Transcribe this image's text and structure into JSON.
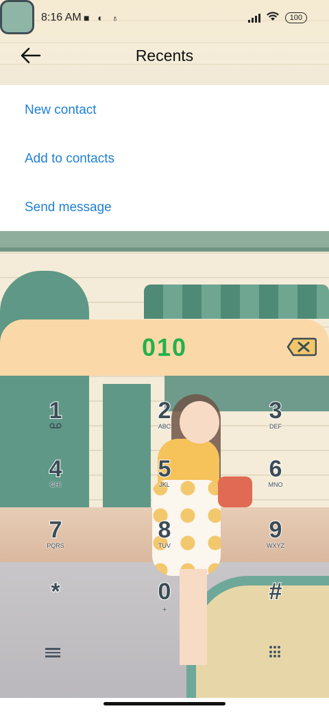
{
  "status_bar": {
    "time": "8:16 AM",
    "battery": "100"
  },
  "header": {
    "title": "Recents"
  },
  "menu": {
    "items": [
      {
        "label": "New contact"
      },
      {
        "label": "Add to contacts"
      },
      {
        "label": "Send message"
      }
    ]
  },
  "dialer": {
    "number": "010",
    "keys": [
      {
        "digit": "1",
        "letters": ""
      },
      {
        "digit": "2",
        "letters": "ABC"
      },
      {
        "digit": "3",
        "letters": "DEF"
      },
      {
        "digit": "4",
        "letters": "GHI"
      },
      {
        "digit": "5",
        "letters": "JKL"
      },
      {
        "digit": "6",
        "letters": "MNO"
      },
      {
        "digit": "7",
        "letters": "PQRS"
      },
      {
        "digit": "8",
        "letters": "TUV"
      },
      {
        "digit": "9",
        "letters": "WXYZ"
      },
      {
        "digit": "*",
        "letters": ""
      },
      {
        "digit": "0",
        "letters": "+"
      },
      {
        "digit": "#",
        "letters": ""
      }
    ]
  },
  "colors": {
    "accent": "#1f7fd6",
    "number": "#21b24b",
    "pill": "#fbd8a8"
  },
  "icons": [
    "back-arrow-icon",
    "voicemail-icon",
    "delete-icon",
    "menu-icon",
    "dialpad-icon",
    "robot-icon"
  ]
}
